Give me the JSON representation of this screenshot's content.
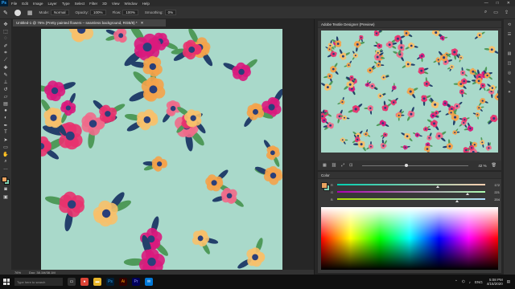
{
  "menubar": {
    "logo": "Ps",
    "items": [
      "File",
      "Edit",
      "Image",
      "Layer",
      "Type",
      "Select",
      "Filter",
      "3D",
      "View",
      "Window",
      "Help"
    ],
    "window_controls": [
      "—",
      "□",
      "✕"
    ]
  },
  "options": {
    "mode_label": "Mode:",
    "mode_value": "Normal",
    "opacity_label": "Opacity:",
    "opacity_value": "100%",
    "flow_label": "Flow:",
    "flow_value": "100%",
    "smoothing_label": "Smoothing:",
    "smoothing_value": "0%"
  },
  "document": {
    "tab_title": "Untitled-1 @ 76% (Pretty painted flowers – seamless background, RGB/8) *",
    "status_zoom": "76%",
    "status_doc": "Doc: 38.1M/38.1M"
  },
  "preview_panel": {
    "title": "Adobe Textile Designer (Preview)",
    "zoom": "42 %"
  },
  "color_panel": {
    "title": "Color",
    "rows": [
      {
        "channel": "R",
        "value": "172",
        "pos": 0.67,
        "gradient": "linear-gradient(to right, #00cfb0, #ffcfb0)"
      },
      {
        "channel": "G",
        "value": "221",
        "pos": 0.87,
        "gradient": "linear-gradient(to right, #ac00b0, #acffb0)"
      },
      {
        "channel": "B",
        "value": "204",
        "pos": 0.8,
        "gradient": "linear-gradient(to right, #acdd00, #acddff)"
      }
    ],
    "foreground": "#e8a15e",
    "background": "#7fcfb0"
  },
  "taskbar": {
    "search_placeholder": "Type here to search",
    "language": "ENG",
    "time": "5:08 PM",
    "date": "4/15/2020"
  },
  "colors": {
    "pattern_bg": "#a9d9ca",
    "petal_pink": "#e8326e",
    "petal_orange": "#f4a24a",
    "petal_magenta": "#d91a7d",
    "leaf_green": "#4f9a5a",
    "leaf_navy": "#23406b"
  }
}
